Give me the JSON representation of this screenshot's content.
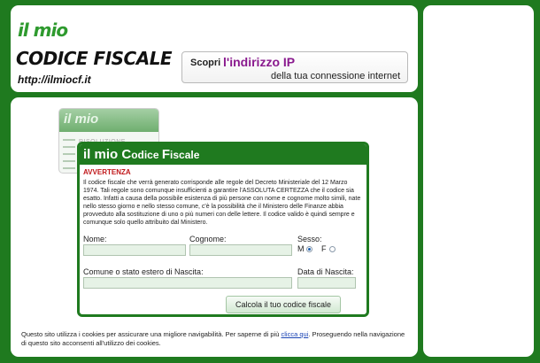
{
  "header": {
    "logo_mark": "il mio",
    "logo_title": "CODICE FISCALE",
    "logo_url": "http://ilmiocf.it",
    "ip_box": {
      "scopri": "Scopri",
      "link": "l'indirizzo IP",
      "sub": "della tua connessione internet"
    }
  },
  "thumbnail": {
    "logo": "il mio",
    "caption": "RISOLUZIONE..."
  },
  "card": {
    "title_a": "il mio ",
    "title_c": "C",
    "title_b": "odice ",
    "title_f": "F",
    "title_d": "iscale",
    "warning_title": "AVVERTENZA",
    "warning_text": "Il codice fiscale che verrà generato corrisponde alle regole del Decreto Ministeriale del 12 Marzo 1974. Tali regole sono comunque insufficienti a garantire l'ASSOLUTA CERTEZZA che il codice sia esatto. Infatti a causa della possibile esistenza di più persone con nome e cognome molto simili, nate nello stesso giorno e nello stesso comune, c'è la possibilità che il Ministero delle Finanze abbia provveduto alla sostituzione di uno o più numeri con delle lettere. Il codice valido è quindi sempre e comunque solo quello attribuito dal Ministero.",
    "form": {
      "nome_label": "Nome:",
      "cognome_label": "Cognome:",
      "sesso_label": "Sesso:",
      "male_label": "M",
      "female_label": "F",
      "selected_sex": "M",
      "comune_label": "Comune o stato estero di Nascita:",
      "data_label": "Data di Nascita:",
      "submit_label": "Calcola il tuo codice fiscale"
    }
  },
  "cookie": {
    "text_before": "Questo sito utilizza i cookies per assicurare una migliore navigabilità. Per saperne di più ",
    "link_label": "clicca qui",
    "text_after": ". Proseguendo nella navigazione di questo sito acconsenti all'utilizzo dei cookies."
  },
  "colors": {
    "background": "#1f7a1f",
    "accent_green": "#1f7a1f",
    "warning_red": "#c0171a",
    "ip_link_purple": "#8a1a8e"
  }
}
